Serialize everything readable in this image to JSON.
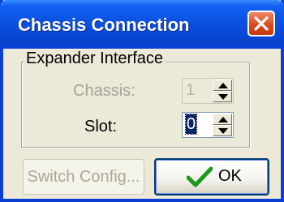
{
  "window": {
    "title": "Chassis Connection"
  },
  "group": {
    "label": "Expander Interface"
  },
  "fields": {
    "chassis": {
      "label": "Chassis:",
      "value": "1"
    },
    "slot": {
      "label": "Slot:",
      "value": "0"
    }
  },
  "buttons": {
    "switch_config": "Switch Config...",
    "ok": "OK"
  },
  "icons": {
    "ok": "checkmark-icon",
    "close": "close-icon"
  },
  "colors": {
    "titlebar": "#0a4fe0",
    "close": "#d8471c",
    "check": "#1a9a1a"
  }
}
